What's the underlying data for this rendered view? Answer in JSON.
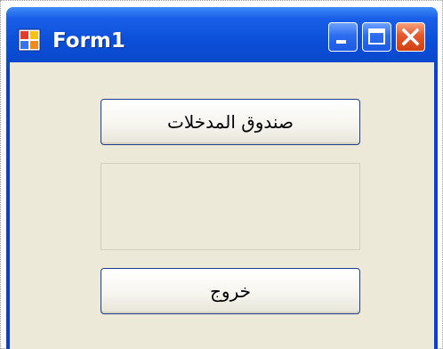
{
  "window": {
    "title": "Form1",
    "icon": "form-app-icon",
    "caption_buttons": [
      "minimize-icon",
      "maximize-icon",
      "close-icon"
    ]
  },
  "form": {
    "input_box_button_label": "صندوق المدخلات",
    "output_label_text": "",
    "exit_button_label": "خروج"
  },
  "colors": {
    "titlebar": "#0b4fd8",
    "client_background": "#ece9d8",
    "close_button": "#d24012"
  }
}
